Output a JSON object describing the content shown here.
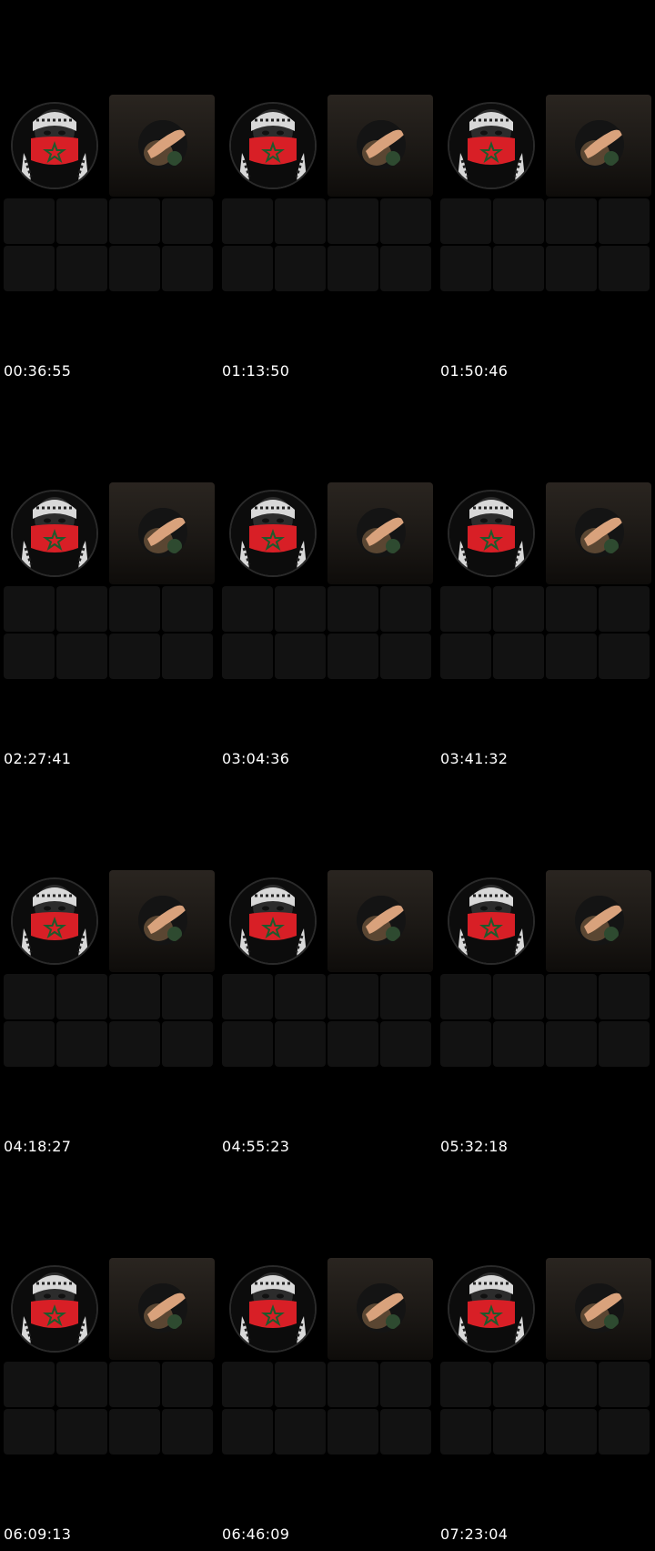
{
  "frames": [
    {
      "timestamp": "00:36:55"
    },
    {
      "timestamp": "01:13:50"
    },
    {
      "timestamp": "01:50:46"
    },
    {
      "timestamp": "02:27:41"
    },
    {
      "timestamp": "03:04:36"
    },
    {
      "timestamp": "03:41:32"
    },
    {
      "timestamp": "04:18:27"
    },
    {
      "timestamp": "04:55:23"
    },
    {
      "timestamp": "05:32:18"
    },
    {
      "timestamp": "06:09:13"
    },
    {
      "timestamp": "06:46:09"
    },
    {
      "timestamp": "07:23:04"
    }
  ],
  "icons": {
    "avatar": "masked-person-avatar",
    "video": "hand-video-thumbnail"
  },
  "colors": {
    "background": "#000000",
    "timestamp_text": "#ffffff",
    "mask_red": "#d81f26",
    "star_green": "#1e5a2c",
    "placeholder_slot": "#121212"
  }
}
